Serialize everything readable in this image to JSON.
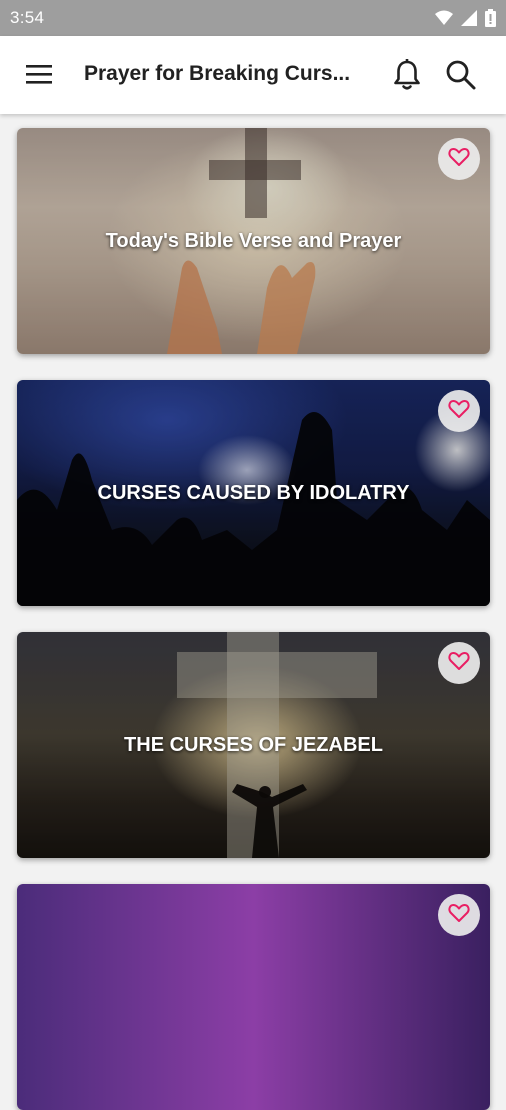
{
  "status_bar": {
    "time": "3:54",
    "icons": [
      "wifi-icon",
      "signal-icon",
      "battery-icon"
    ]
  },
  "app_bar": {
    "title": "Prayer for Breaking Curs...",
    "icons": [
      "menu-icon",
      "bell-icon",
      "search-icon"
    ]
  },
  "cards": [
    {
      "title": "Today's Bible Verse and Prayer",
      "favorite_icon": "heart-outline-icon"
    },
    {
      "title": "CURSES CAUSED BY IDOLATRY",
      "favorite_icon": "heart-outline-icon"
    },
    {
      "title": "THE CURSES OF JEZABEL",
      "favorite_icon": "heart-outline-icon"
    },
    {
      "title": "",
      "favorite_icon": "heart-outline-icon"
    }
  ],
  "colors": {
    "status_bar": "#9e9e9e",
    "app_bar": "#ffffff",
    "heart": "#e91e63",
    "background": "#f2f2f2"
  }
}
